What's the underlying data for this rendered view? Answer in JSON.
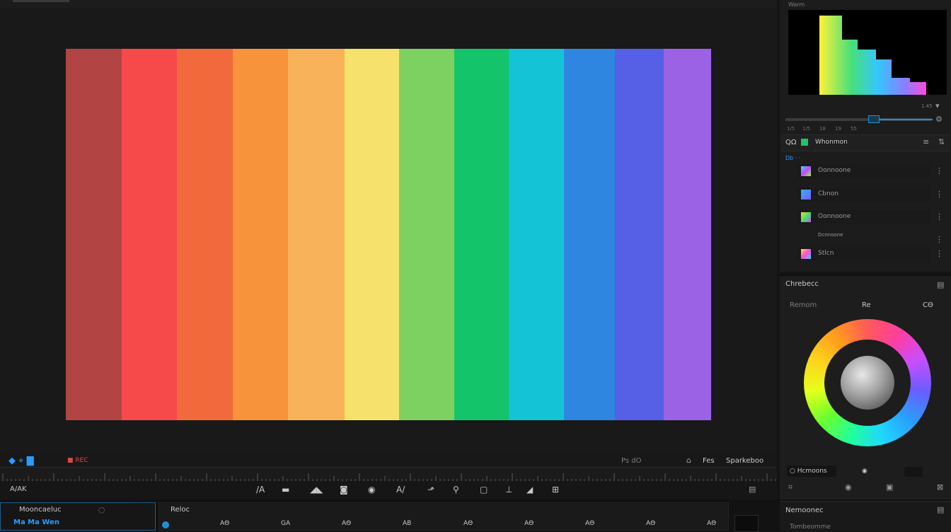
{
  "viewer": {
    "color_bars": [
      "#b34444",
      "#f64a4a",
      "#f26a3c",
      "#f7933a",
      "#f8b25a",
      "#f5e16b",
      "#7dd160",
      "#14c46a",
      "#14c3d6",
      "#2f86e0",
      "#5560e6",
      "#9b62e6"
    ]
  },
  "transport": {
    "left_label": "◆ ⌖ ▇",
    "rec_label": "■ REC",
    "timecode": "Ps dΟ",
    "right_label": "Sparkeboo",
    "mid_label": "Fes"
  },
  "toolbar": {
    "left_label": "A/AK",
    "tools": [
      "/A",
      "▬",
      "◢◣",
      "◙",
      "◉",
      "A/",
      "⬏",
      "⚲",
      "▢",
      "⊥",
      "◢",
      "⊞"
    ]
  },
  "bin": {
    "title": "Mooncaeluc",
    "subtitle": "Ma Ma Wen"
  },
  "timeline": {
    "title": "Reloc",
    "markers": [
      "AΘ",
      "GA",
      "AΘ",
      "AB",
      "AΘ",
      "AΘ",
      "AΘ",
      "AΘ",
      "AΘ"
    ]
  },
  "right_panel": {
    "histogram_label": "Warm",
    "hist_right_label": "1.45",
    "tick_labels": [
      "1/5",
      "1/5",
      "18",
      "19",
      "55"
    ],
    "layers_header": "Whonmon",
    "layers_header_prefix": "QΩ",
    "group_label": "Db  ·  ·",
    "layers": [
      {
        "label": "Oonnoone",
        "swatch": "linear-gradient(135deg,#3fd5ff,#c24bff,#8cff3a)"
      },
      {
        "label": "Cbnon",
        "swatch": "linear-gradient(135deg,#2bb6ff,#7b5bff)"
      },
      {
        "label": "Oonnoone",
        "swatch": "linear-gradient(135deg,#ffd23a,#43e06a,#d84bff)"
      },
      {
        "label": "Dcnnoone",
        "swatch": ""
      },
      {
        "label": "Stlcn",
        "swatch": "linear-gradient(135deg,#ffe23a,#ff4bd6,#3fd5ff)"
      }
    ]
  },
  "color_panel": {
    "title": "Chrebecc",
    "mode_left": "Remom",
    "mode_mid": "Re",
    "mode_right": "CΘ",
    "bottom_label": "○ Hcmoons",
    "bottom_icon": "◉"
  },
  "bottom_panel": {
    "title": "Nemoonec",
    "subtitle": "Tombeomme"
  }
}
